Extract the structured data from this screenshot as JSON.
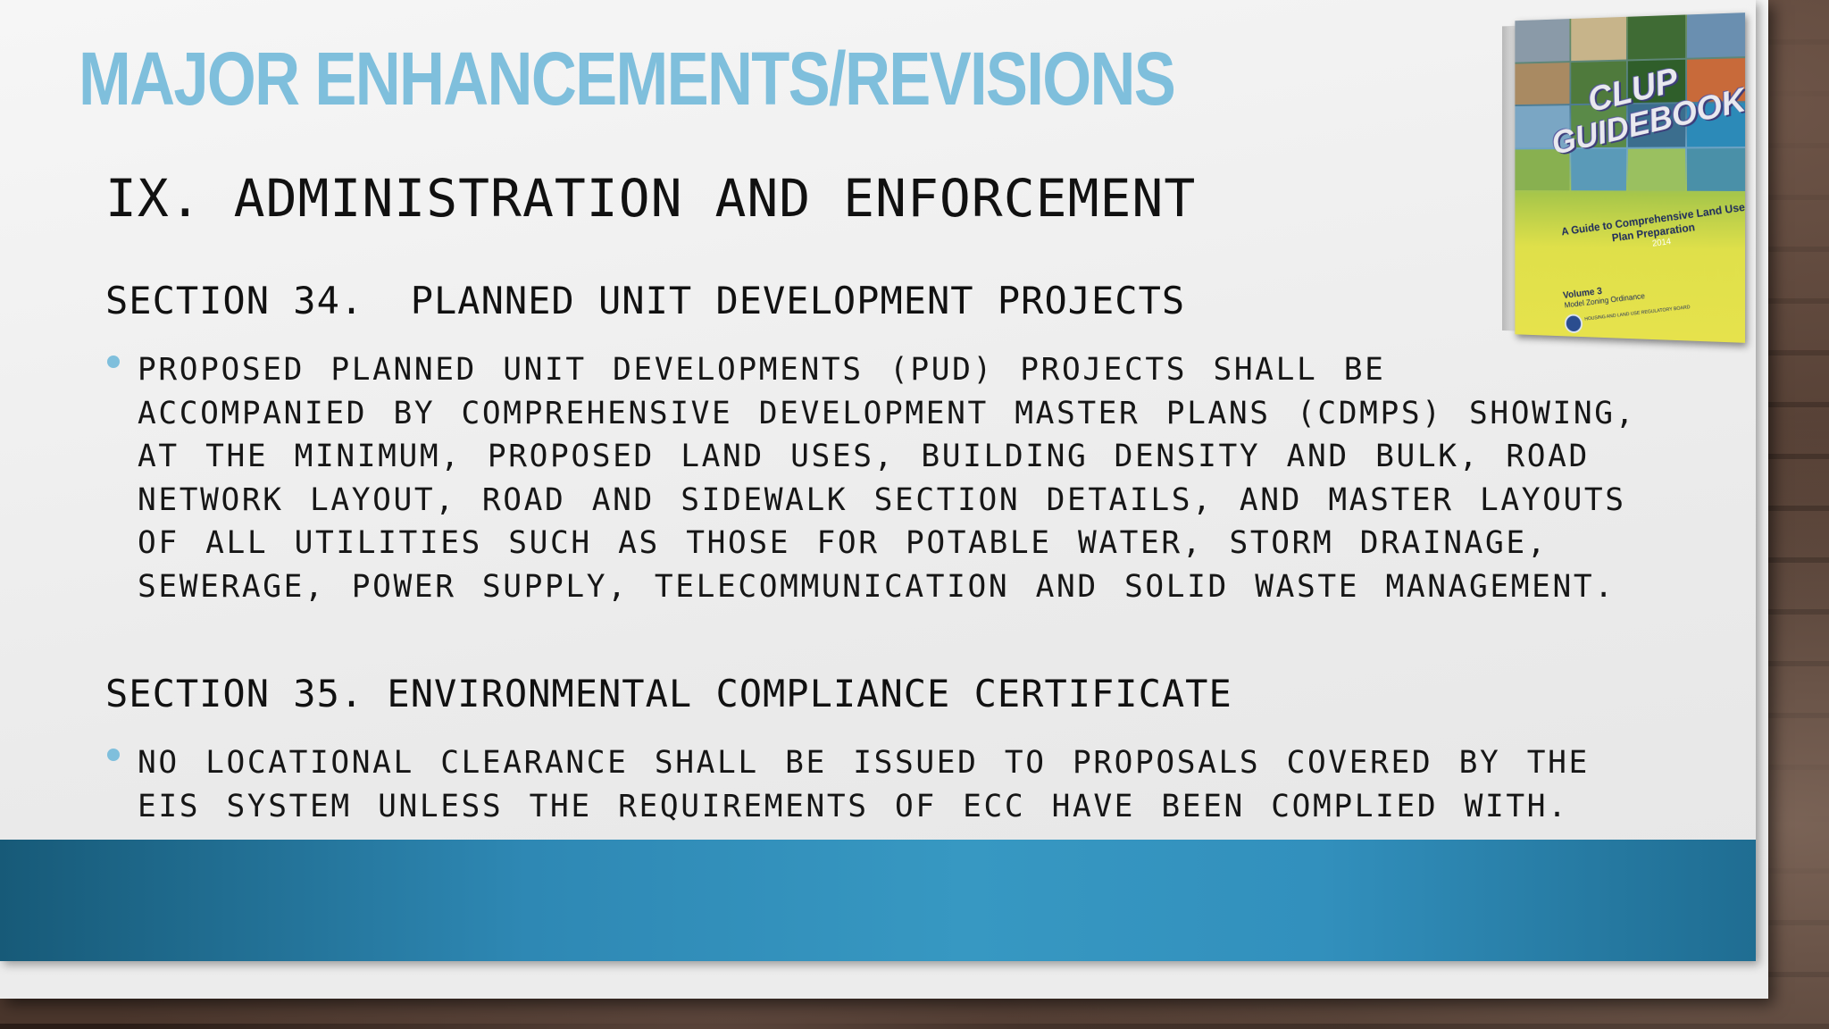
{
  "slide": {
    "title": "MAJOR ENHANCEMENTS/REVISIONS",
    "heading": "IX. ADMINISTRATION AND ENFORCEMENT",
    "sections": [
      {
        "heading": "SECTION 34.  PLANNED UNIT DEVELOPMENT PROJECTS",
        "bullet": "PROPOSED PLANNED UNIT DEVELOPMENTS (PUD) PROJECTS SHALL BE ACCOMPANIED BY COMPREHENSIVE DEVELOPMENT MASTER PLANS (CDMPS) SHOWING, AT THE MINIMUM, PROPOSED LAND USES, BUILDING DENSITY AND BULK, ROAD NETWORK LAYOUT, ROAD AND SIDEWALK SECTION DETAILS, AND MASTER LAYOUTS OF ALL UTILITIES SUCH AS THOSE FOR POTABLE WATER, STORM DRAINAGE, SEWERAGE, POWER SUPPLY, TELECOMMUNICATION AND SOLID WASTE MANAGEMENT."
      },
      {
        "heading": "SECTION 35. ENVIRONMENTAL COMPLIANCE CERTIFICATE",
        "bullet": "NO LOCATIONAL CLEARANCE SHALL BE ISSUED TO PROPOSALS COVERED BY THE EIS SYSTEM UNLESS THE REQUIREMENTS OF ECC HAVE BEEN COMPLIED WITH."
      }
    ]
  },
  "book": {
    "title_line1": "CLUP",
    "title_line2": "GUIDEBOOK",
    "subtitle": "A Guide to Comprehensive Land Use Plan Preparation",
    "year": "2014",
    "volume": "Volume 3",
    "volume_subtitle": "Model Zoning Ordinance",
    "publisher": "HOUSING AND LAND USE REGULATORY BOARD"
  },
  "colors": {
    "title": "#7fbfdc",
    "bullet": "#7fbfdc",
    "band": "#3798c2"
  }
}
